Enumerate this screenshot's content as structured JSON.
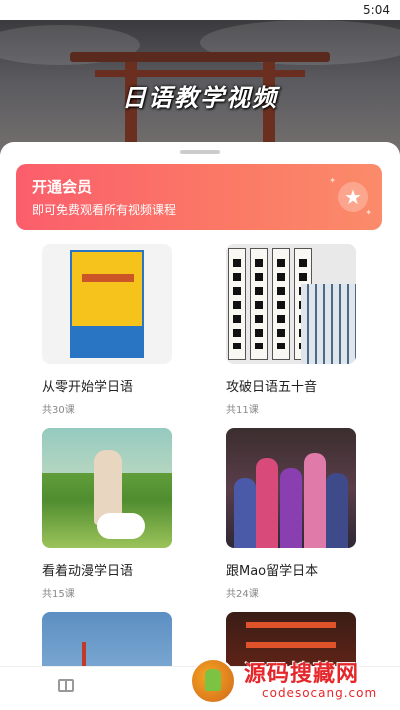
{
  "status_bar": {
    "time": "5:04"
  },
  "hero": {
    "title": "日语教学视频"
  },
  "vip_banner": {
    "title": "开通会员",
    "subtitle": "即可免费观看所有视频课程",
    "icon": "star-icon"
  },
  "courses": [
    {
      "name": "从零开始学日语",
      "count": "共30课"
    },
    {
      "name": "攻破日语五十音",
      "count": "共11课"
    },
    {
      "name": "看着动漫学日语",
      "count": "共15课"
    },
    {
      "name": "跟Mao留学日本",
      "count": "共24课"
    }
  ],
  "bottom_nav": {
    "items": [
      {
        "icon": "book-icon"
      },
      {
        "icon": "vip-icon"
      }
    ]
  },
  "watermark": {
    "cn": "源码搜藏网",
    "en": "codesocang.com"
  }
}
